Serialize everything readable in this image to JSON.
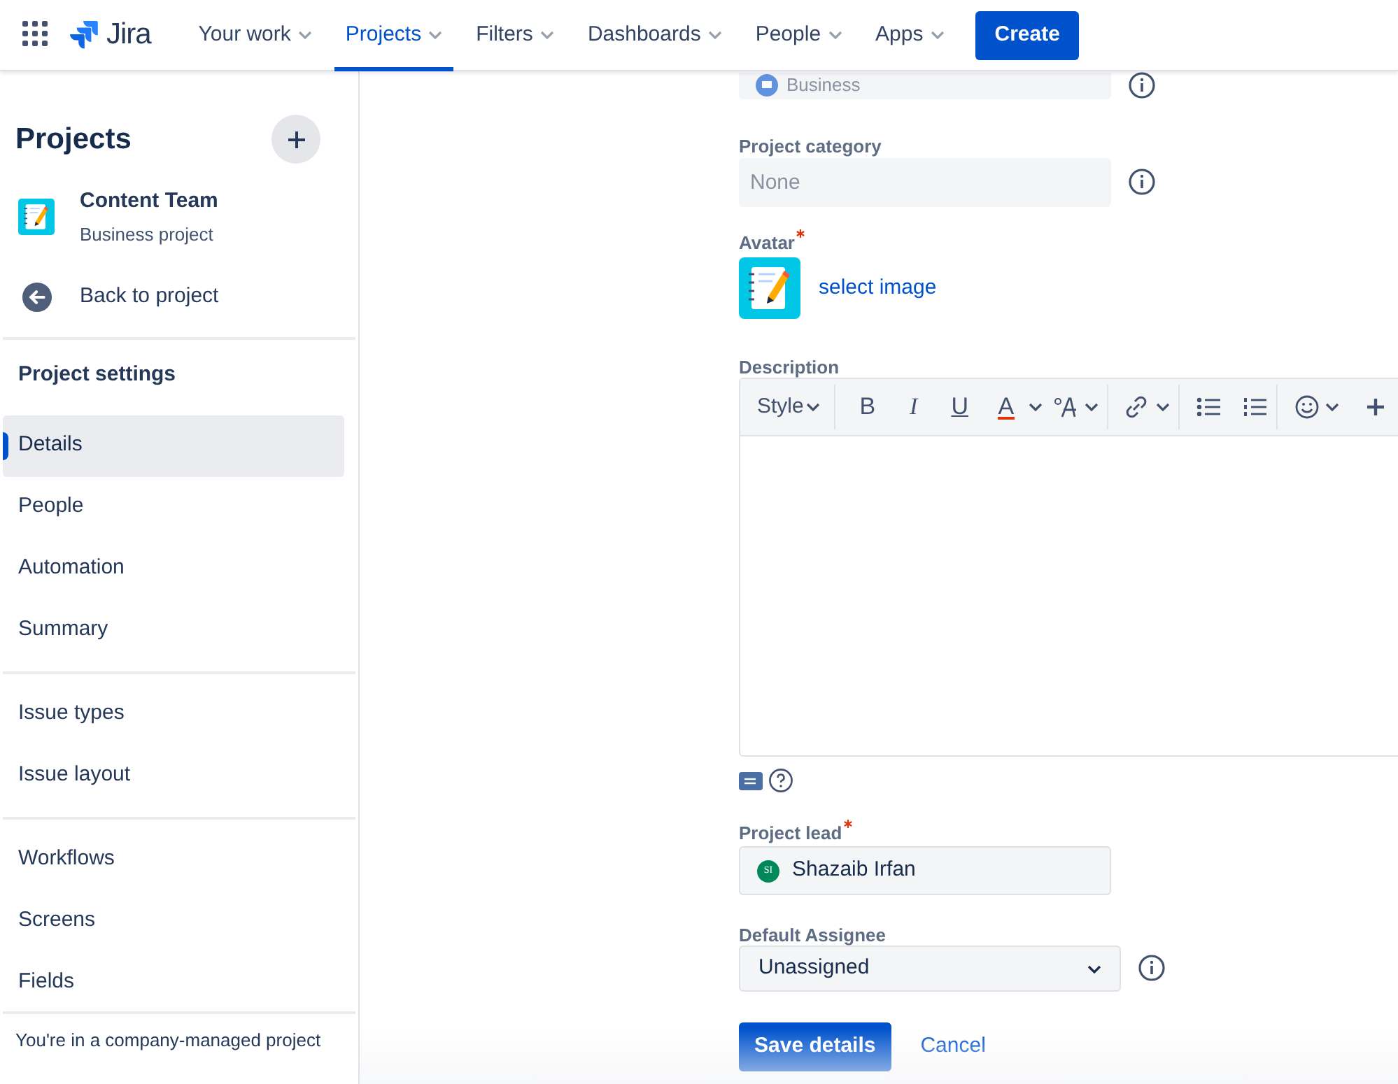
{
  "topbar": {
    "logo": "Jira",
    "menu": [
      {
        "label": "Your work",
        "selected": false
      },
      {
        "label": "Projects",
        "selected": true
      },
      {
        "label": "Filters",
        "selected": false
      },
      {
        "label": "Dashboards",
        "selected": false
      },
      {
        "label": "People",
        "selected": false
      },
      {
        "label": "Apps",
        "selected": false
      }
    ],
    "create": "Create"
  },
  "sidebar": {
    "title": "Projects",
    "project": {
      "name": "Content Team",
      "type": "Business project"
    },
    "back": "Back to project",
    "section": "Project settings",
    "groups": [
      [
        {
          "label": "Details",
          "selected": true
        },
        {
          "label": "People",
          "selected": false
        },
        {
          "label": "Automation",
          "selected": false
        },
        {
          "label": "Summary",
          "selected": false
        }
      ],
      [
        {
          "label": "Issue types",
          "selected": false
        },
        {
          "label": "Issue layout",
          "selected": false
        }
      ],
      [
        {
          "label": "Workflows",
          "selected": false
        },
        {
          "label": "Screens",
          "selected": false
        },
        {
          "label": "Fields",
          "selected": false
        }
      ]
    ],
    "footer": "You're in a company-managed project"
  },
  "form": {
    "project_type": {
      "value": "Business"
    },
    "category": {
      "label": "Project category",
      "placeholder": "None"
    },
    "avatar": {
      "label": "Avatar",
      "required": true,
      "link": "select image"
    },
    "description": {
      "label": "Description",
      "style": "Style",
      "format_buttons": [
        "B",
        "I",
        "U",
        "A"
      ]
    },
    "lead": {
      "label": "Project lead",
      "required": true,
      "initials": "SI",
      "value": "Shazaib Irfan"
    },
    "assignee": {
      "label": "Default Assignee",
      "value": "Unassigned"
    },
    "save": "Save details",
    "cancel": "Cancel"
  }
}
